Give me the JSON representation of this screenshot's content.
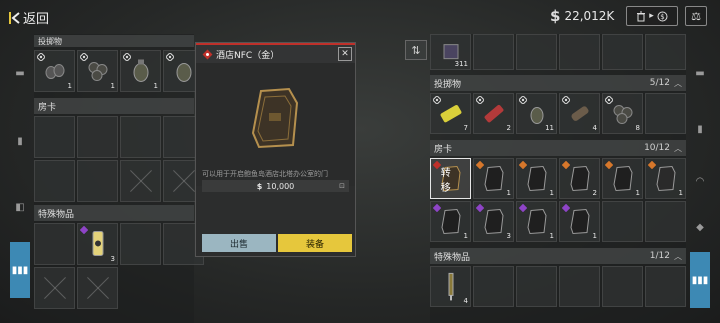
{
  "topbar": {
    "back_label": "返回",
    "currency_value": "22,012K",
    "sell_icon": "trash-icon",
    "scale_icon": "scale-icon"
  },
  "left_panel": {
    "throwables": {
      "label": "投掷物",
      "items": [
        {
          "qty": "1"
        },
        {
          "qty": "1"
        },
        {
          "qty": "1"
        },
        {
          "qty": ""
        }
      ]
    },
    "room_cards": {
      "label": "房卡"
    },
    "special_items": {
      "label": "特殊物品",
      "items": [
        {
          "qty": "3"
        }
      ]
    }
  },
  "modal": {
    "title": "酒店NFC（金）",
    "description": "可以用于开启鲍鱼岛酒店北塔办公室的门",
    "price": "10,000",
    "sell_label": "出售",
    "equip_label": "装备"
  },
  "right_panel": {
    "top_item_qty": "311",
    "throwables": {
      "label": "投掷物",
      "count": "5/12",
      "items": [
        {
          "qty": "7"
        },
        {
          "qty": "2"
        },
        {
          "qty": "11"
        },
        {
          "qty": "4"
        },
        {
          "qty": "8"
        }
      ]
    },
    "room_cards": {
      "label": "房卡",
      "count": "10/12",
      "transfer_label": "转移",
      "row1": [
        {
          "qty": "1"
        },
        {
          "qty": "1"
        },
        {
          "qty": "2"
        },
        {
          "qty": "1"
        },
        {
          "qty": "1"
        },
        {
          "qty": "1"
        }
      ],
      "row2": [
        {
          "qty": "1"
        },
        {
          "qty": "3"
        },
        {
          "qty": "1"
        },
        {
          "qty": "1"
        }
      ]
    },
    "special_items": {
      "label": "特殊物品",
      "count": "1/12",
      "items": [
        {
          "qty": "4"
        }
      ]
    }
  },
  "colors": {
    "accent_blue": "#3d89b4",
    "equip_yellow": "#e6c73c",
    "sell_blue": "#9bb6c1",
    "rare_red": "#c0302a",
    "rare_purple": "#8e44c7",
    "rare_orange": "#d6772b"
  }
}
